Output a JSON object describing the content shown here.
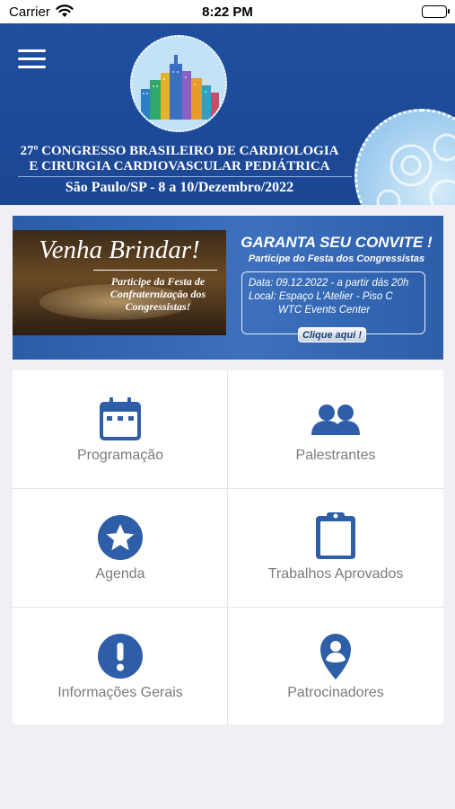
{
  "status_bar": {
    "carrier": "Carrier",
    "time": "8:22 PM"
  },
  "header": {
    "title_line_1": "27º CONGRESSO BRASILEIRO DE CARDIOLOGIA",
    "title_line_2": "E CIRURGIA CARDIOVASCULAR PEDIÁTRICA",
    "subtitle": "São Paulo/SP - 8 a 10/Dezembro/2022",
    "brand_color": "#1f4f9e"
  },
  "banner": {
    "headline_script": "Venha Brindar!",
    "photo_caption": "Participe da Festa de Confraternização dos Congressistas!",
    "title": "GARANTA SEU CONVITE !",
    "subtitle": "Participe do Festa dos Congressistas",
    "date_line": "Data: 09.12.2022 - a partir dás 20h",
    "local_line": "Local: Espaço  L'Atelier - Piso C",
    "venue_line": "WTC Events Center",
    "cta": "Clique aqui !"
  },
  "menu": {
    "icon_color": "#2f5ea8",
    "items": [
      {
        "label": "Programação",
        "icon": "calendar-icon"
      },
      {
        "label": "Palestrantes",
        "icon": "people-icon"
      },
      {
        "label": "Agenda",
        "icon": "star-icon"
      },
      {
        "label": "Trabalhos Aprovados",
        "icon": "clipboard-icon"
      },
      {
        "label": "Informações Gerais",
        "icon": "info-icon"
      },
      {
        "label": "Patrocinadores",
        "icon": "map-pin-person-icon"
      }
    ]
  }
}
